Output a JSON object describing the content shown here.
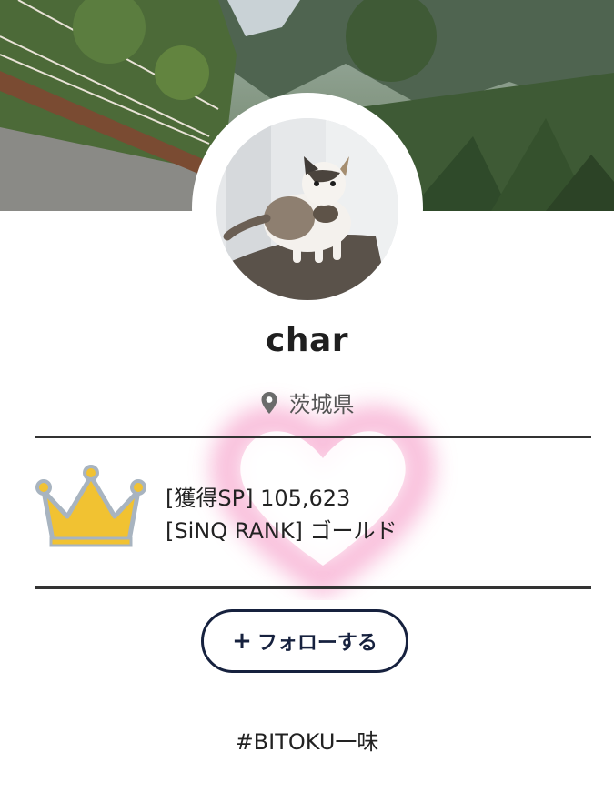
{
  "profile": {
    "username": "char",
    "location": "茨城県",
    "location_icon": "map-pin-icon"
  },
  "stats": {
    "sp_label": "[獲得SP]",
    "sp_value": "105,623",
    "rank_label": "[SiNQ RANK]",
    "rank_value": "ゴールド",
    "rank_icon": "crown-icon"
  },
  "actions": {
    "follow_icon": "+",
    "follow_label": "フォローする"
  },
  "tags": {
    "hashtag": "#BITOKU一味"
  },
  "colors": {
    "button_border": "#16213e",
    "crown_gold": "#f1c232",
    "crown_outline": "#a8b4c0",
    "heart_glow": "#f7a8cf",
    "divider": "#333333"
  }
}
